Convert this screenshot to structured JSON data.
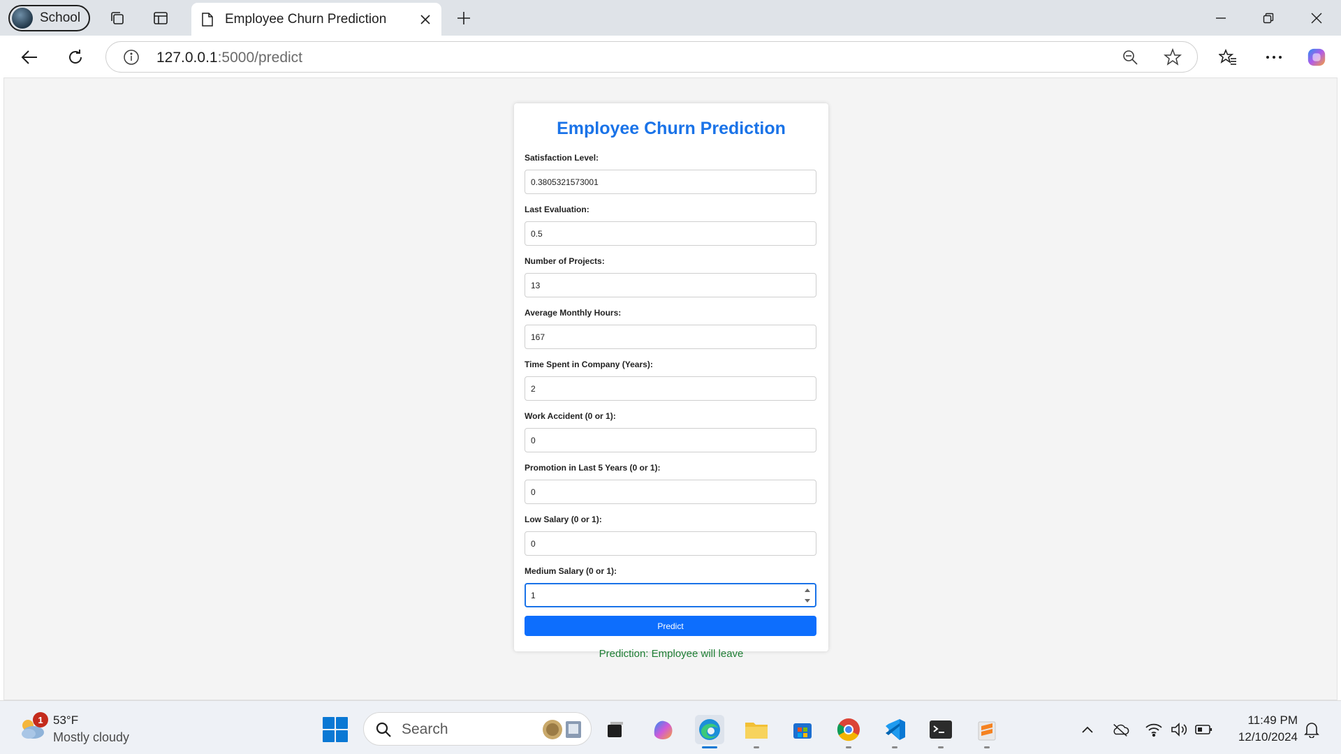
{
  "browser": {
    "profile_label": "School",
    "tab_title": "Employee Churn Prediction",
    "url_host": "127.0.0.1",
    "url_path": ":5000/predict"
  },
  "form": {
    "title": "Employee Churn Prediction",
    "fields": [
      {
        "label": "Satisfaction Level:",
        "value": "0.3805321573001"
      },
      {
        "label": "Last Evaluation:",
        "value": "0.5"
      },
      {
        "label": "Number of Projects:",
        "value": "13"
      },
      {
        "label": "Average Monthly Hours:",
        "value": "167"
      },
      {
        "label": "Time Spent in Company (Years):",
        "value": "2"
      },
      {
        "label": "Work Accident (0 or 1):",
        "value": "0"
      },
      {
        "label": "Promotion in Last 5 Years (0 or 1):",
        "value": "0"
      },
      {
        "label": "Low Salary (0 or 1):",
        "value": "0"
      },
      {
        "label": "Medium Salary (0 or 1):",
        "value": "1"
      }
    ],
    "submit_label": "Predict",
    "result_text": "Prediction: Employee will leave"
  },
  "taskbar": {
    "weather_badge": "1",
    "weather_temp": "53°F",
    "weather_desc": "Mostly cloudy",
    "search_placeholder": "Search",
    "time": "11:49 PM",
    "date": "12/10/2024"
  },
  "colors": {
    "title_blue": "#1a73e8",
    "button_blue": "#0d6efd",
    "result_green": "#1e7e34"
  }
}
